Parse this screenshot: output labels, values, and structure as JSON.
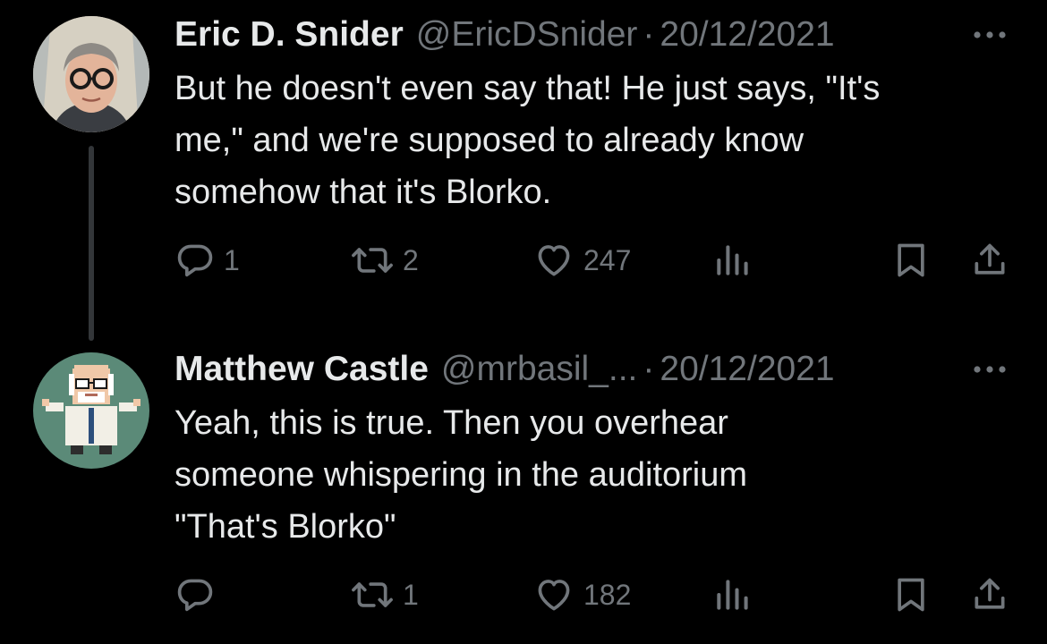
{
  "tweets": [
    {
      "author_name": "Eric D. Snider",
      "handle": "@EricDSnider",
      "separator": "·",
      "date": "20/12/2021",
      "text_lines": [
        "But he doesn't even say that! He just says, \"It's",
        "me,\" and we're supposed to already know",
        "somehow that it's Blorko."
      ],
      "replies": "1",
      "retweets": "2",
      "likes": "247",
      "avatar_icon": "profile-photo-man-glasses"
    },
    {
      "author_name": "Matthew Castle",
      "handle": "@mrbasil_...",
      "separator": "·",
      "date": "20/12/2021",
      "text_lines": [
        "Yeah, this is true. Then you overhear",
        "someone whispering in the auditorium",
        "\"That's Blorko\""
      ],
      "replies": "",
      "retweets": "1",
      "likes": "182",
      "avatar_icon": "pixel-art-scientist"
    }
  ],
  "icons": {
    "reply": "reply-icon",
    "retweet": "retweet-icon",
    "like": "heart-icon",
    "views": "views-icon",
    "bookmark": "bookmark-icon",
    "share": "share-icon",
    "more": "more-icon"
  },
  "colors": {
    "background": "#000000",
    "primary_text": "#e7e9ea",
    "secondary_text": "#71767b",
    "thread_line": "#333639"
  }
}
